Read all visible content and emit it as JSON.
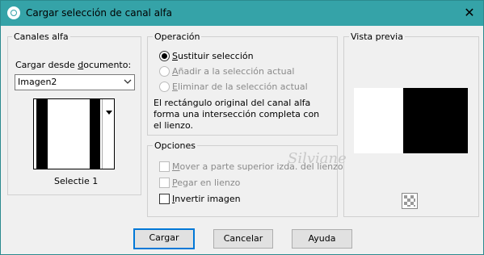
{
  "title_bar": {
    "title": "Cargar selección de canal alfa",
    "close_glyph": "✕",
    "app_icon": "psp-app-icon"
  },
  "canales": {
    "legend": "Canales alfa",
    "load_label_pre": "Cargar desde ",
    "load_label_u": "d",
    "load_label_post": "ocumento:",
    "document_value": "Imagen2",
    "dropdown_icon": "chevron-down-icon",
    "channel_name": "Selectie 1"
  },
  "operacion": {
    "legend": "Operación",
    "options": [
      {
        "u": "S",
        "rest": "ustituir selección",
        "selected": true,
        "enabled": true
      },
      {
        "u": "A",
        "rest": "ñadir a la selección actual",
        "selected": false,
        "enabled": false
      },
      {
        "u": "E",
        "rest": "liminar de la selección actual",
        "selected": false,
        "enabled": false
      }
    ],
    "note_line1": "El rectángulo original del canal alfa",
    "note_line2": "forma una intersección completa con",
    "note_line3": "el lienzo."
  },
  "opciones": {
    "legend": "Opciones",
    "items": [
      {
        "u": "M",
        "rest": "over a parte superior izda. del lienzo",
        "checked": false,
        "enabled": false
      },
      {
        "u": "P",
        "rest": "egar en lienzo",
        "checked": false,
        "enabled": false
      },
      {
        "u": "I",
        "rest": "nvertir imagen",
        "checked": false,
        "enabled": true
      }
    ]
  },
  "vista_previa": {
    "legend": "Vista previa",
    "zoom_icon": "checker-zoom-icon"
  },
  "buttons": {
    "ok": "Cargar",
    "cancel": "Cancelar",
    "help": "Ayuda"
  },
  "watermark": "Silviane"
}
